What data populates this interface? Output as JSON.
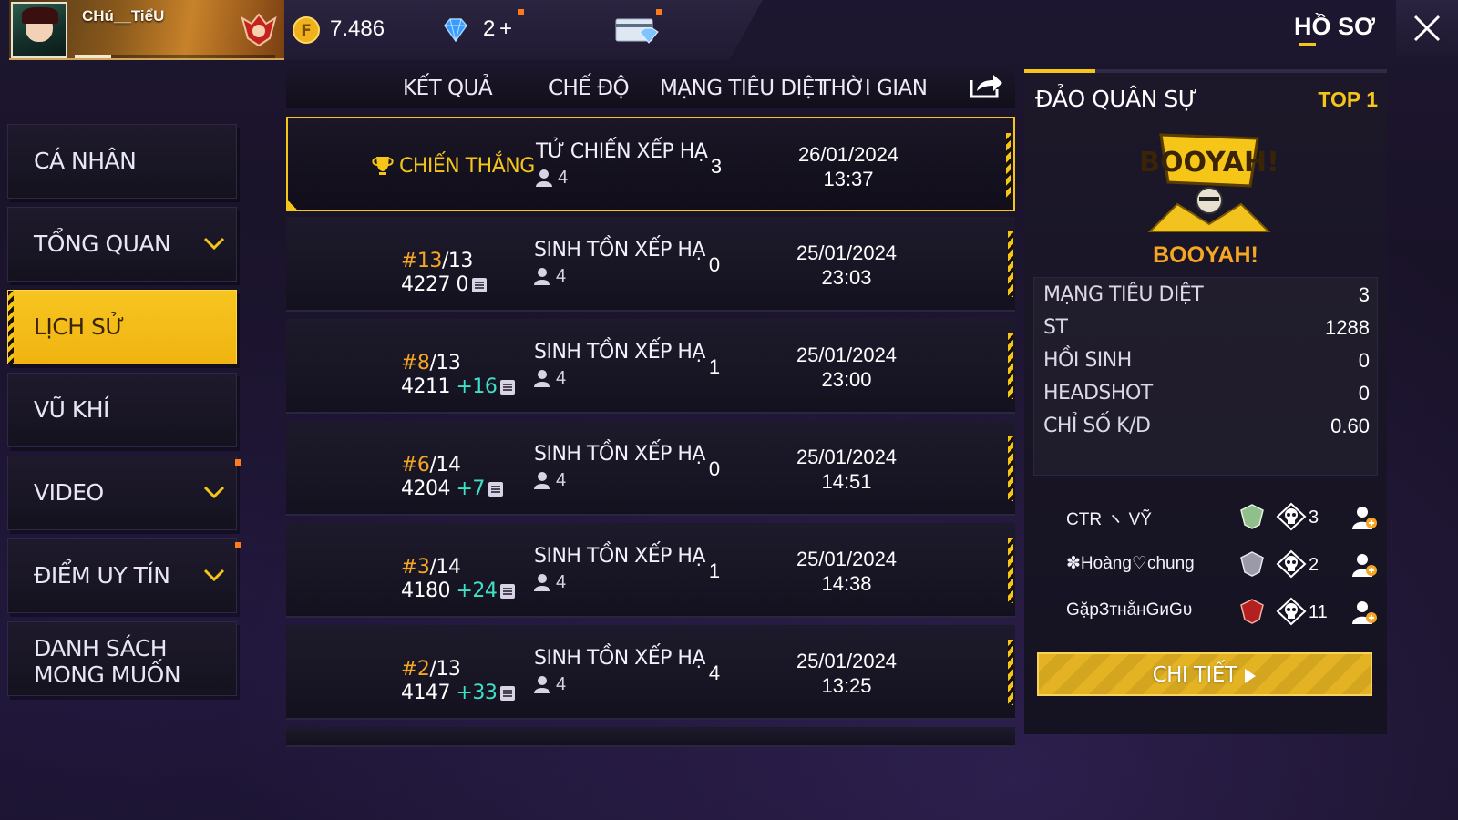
{
  "player": {
    "name": "CHú__TiểU"
  },
  "currency": {
    "gold": "7.486",
    "diamonds": "2",
    "diamond_plus": "+"
  },
  "header": {
    "profile_tab": "HỒ SƠ"
  },
  "sidebar": {
    "items": [
      {
        "label": "CÁ NHÂN"
      },
      {
        "label": "TỔNG QUAN"
      },
      {
        "label": "LỊCH SỬ"
      },
      {
        "label": "VŨ KHÍ"
      },
      {
        "label": "VIDEO"
      },
      {
        "label": "ĐIỂM UY TÍN"
      },
      {
        "label_line1": "DANH SÁCH",
        "label_line2": "MONG MUỐN"
      }
    ]
  },
  "table": {
    "headers": {
      "result": "KẾT QUẢ",
      "mode": "CHẾ ĐỘ",
      "kills": "MẠNG TIÊU DIỆT",
      "time": "THỜI GIAN"
    },
    "rows": [
      {
        "result": "CHIẾN THẮNG",
        "mode": "TỬ CHIẾN XẾP HẠ",
        "party": "4",
        "kills": "3",
        "date": "26/01/2024",
        "time": "13:37"
      },
      {
        "rank_hash": "#13",
        "rank_total": "/13",
        "points": "4227",
        "delta": "0",
        "mode": "SINH TỒN XẾP HẠ",
        "party": "4",
        "kills": "0",
        "date": "25/01/2024",
        "time": "23:03"
      },
      {
        "rank_hash": "#8",
        "rank_total": "/13",
        "points": "4211",
        "delta": "+16",
        "mode": "SINH TỒN XẾP HẠ",
        "party": "4",
        "kills": "1",
        "date": "25/01/2024",
        "time": "23:00"
      },
      {
        "rank_hash": "#6",
        "rank_total": "/14",
        "points": "4204",
        "delta": "+7",
        "mode": "SINH TỒN XẾP HẠ",
        "party": "4",
        "kills": "0",
        "date": "25/01/2024",
        "time": "14:51"
      },
      {
        "rank_hash": "#3",
        "rank_total": "/14",
        "points": "4180",
        "delta": "+24",
        "mode": "SINH TỒN XẾP HẠ",
        "party": "4",
        "kills": "1",
        "date": "25/01/2024",
        "time": "14:38"
      },
      {
        "rank_hash": "#2",
        "rank_total": "/13",
        "points": "4147",
        "delta": "+33",
        "mode": "SINH TỒN XẾP HẠ",
        "party": "4",
        "kills": "4",
        "date": "25/01/2024",
        "time": "13:25"
      }
    ]
  },
  "detail": {
    "map": "ĐẢO QUÂN SỰ",
    "placement": "TOP 1",
    "booyah_label": "BOOYAH!",
    "stats": [
      {
        "key": "MẠNG TIÊU DIỆT",
        "value": "3"
      },
      {
        "key": "ST",
        "value": "1288"
      },
      {
        "key": "HỒI SINH",
        "value": "0"
      },
      {
        "key": "HEADSHOT",
        "value": "0"
      },
      {
        "key": "CHỈ SỐ K/D",
        "value": "0.60"
      }
    ],
    "teammates": [
      {
        "name": "CTR ヽ VỸ",
        "kills": "3"
      },
      {
        "name": "✽Hoàng♡chung",
        "kills": "2"
      },
      {
        "name": "GặpЗтнằнGиGυ",
        "kills": "11"
      }
    ],
    "details_button": "CHI TIẾT"
  },
  "colors": {
    "accent": "#f5c518",
    "positive": "#3ee0c6",
    "rank_hash": "#f5a623"
  },
  "icons": [
    "gold-coin-icon",
    "diamond-icon",
    "card-icon",
    "close-icon",
    "chevron-down-icon",
    "share-icon",
    "trophy-icon",
    "party-icon",
    "note-icon",
    "skull-icon",
    "add-friend-icon",
    "play-icon"
  ]
}
